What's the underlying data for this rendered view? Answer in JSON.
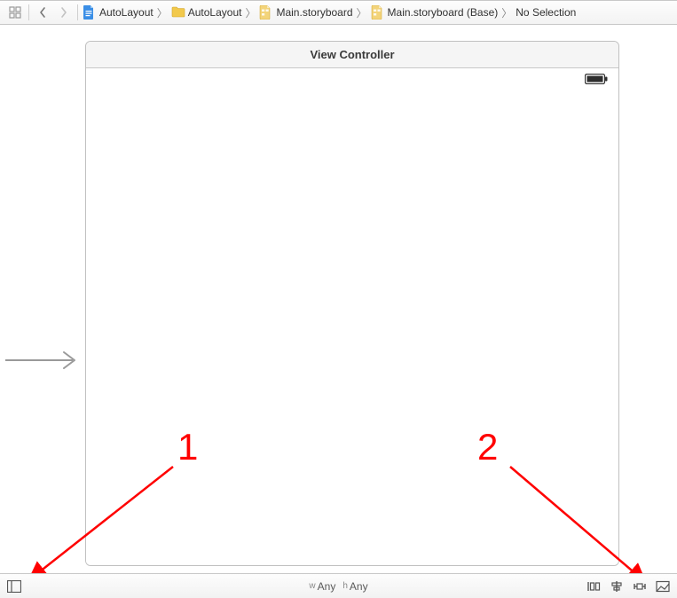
{
  "nav": {
    "crumbs": [
      {
        "label": "AutoLayout",
        "icon": "file-blue"
      },
      {
        "label": "AutoLayout",
        "icon": "folder-yellow"
      },
      {
        "label": "Main.storyboard",
        "icon": "file-yellow"
      },
      {
        "label": "Main.storyboard (Base)",
        "icon": "file-yellow"
      },
      {
        "label": "No Selection",
        "icon": null
      }
    ]
  },
  "scene": {
    "title": "View Controller"
  },
  "bottombar": {
    "w_prefix": "w",
    "w_value": "Any",
    "h_prefix": "h",
    "h_value": "Any"
  },
  "annotations": {
    "label1": "1",
    "label2": "2"
  }
}
